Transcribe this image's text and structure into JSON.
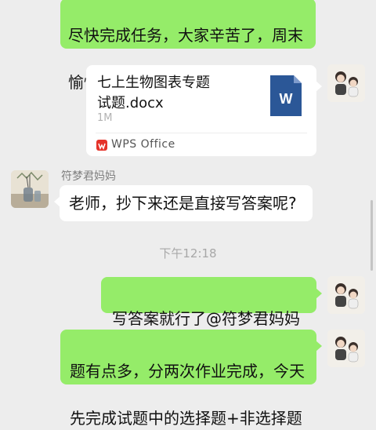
{
  "messages": {
    "top_bubble": {
      "line1": "尽快完成任务，大家辛苦了，周末",
      "line2": "愉快",
      "emoji": "😁😁"
    },
    "file": {
      "title_line1": "七上生物图表专题",
      "title_line2": "试题.docx",
      "size": "1M",
      "app": "WPS Office",
      "doc_icon_letter": "W"
    },
    "incoming": {
      "sender": "符梦君妈妈",
      "text": "老师，抄下来还是直接写答案呢?"
    },
    "timestamp": "下午12:18",
    "reply1": "写答案就行了@符梦君妈妈",
    "reply2": {
      "line1": "题有点多，分两次作业完成，今天",
      "line2": "先完成试题中的选择题+非选择题"
    }
  },
  "colors": {
    "background": "#ededed",
    "outgoing_bubble": "#95ec69",
    "incoming_bubble": "#ffffff",
    "word_blue": "#2b5797",
    "wps_red": "#e5332a"
  }
}
